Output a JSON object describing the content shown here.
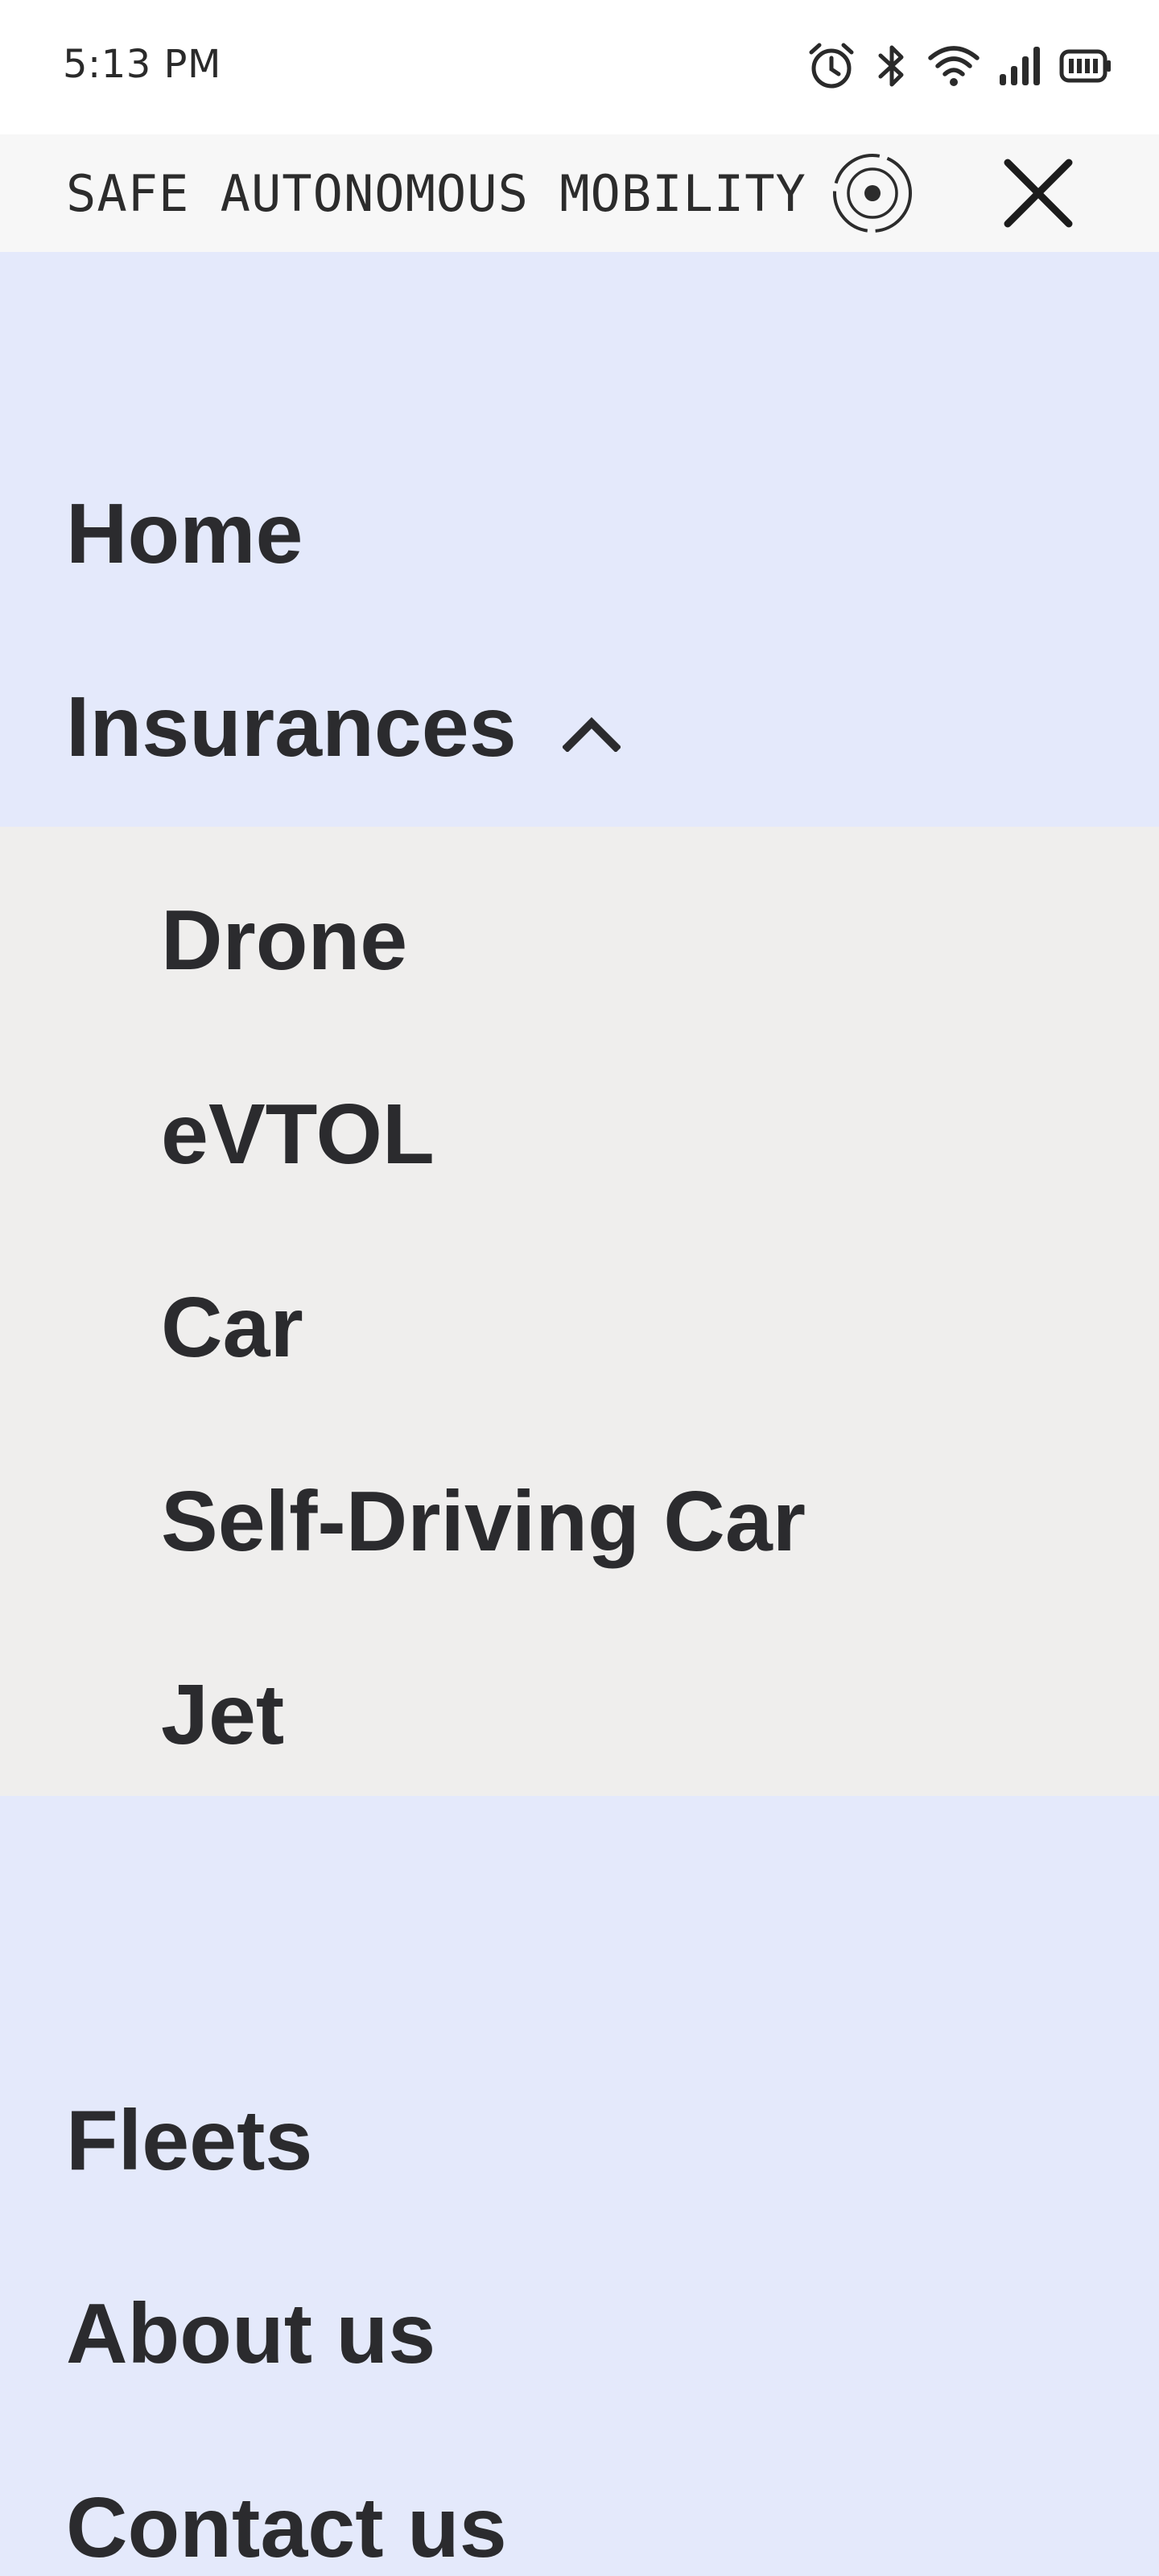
{
  "status_bar": {
    "time": "5:13 PM",
    "icons": [
      "alarm-icon",
      "bluetooth-icon",
      "wifi-icon",
      "signal-icon",
      "battery-icon"
    ]
  },
  "header": {
    "brand": "SAFE AUTONOMOUS MOBILITY",
    "logo_icon": "target-logo-icon",
    "close_icon": "close-icon"
  },
  "menu": {
    "home": "Home",
    "insurances": "Insurances",
    "insurances_expanded": true,
    "insurance_items": [
      "Drone",
      "eVTOL",
      "Car",
      "Self-Driving Car",
      "Jet"
    ],
    "fleets": "Fleets",
    "about": "About us",
    "contact": "Contact us"
  },
  "colors": {
    "menu_background": "#e4e9fb",
    "submenu_background": "#efeeed",
    "header_background": "#f7f7f7",
    "text": "#2b2b2e"
  }
}
